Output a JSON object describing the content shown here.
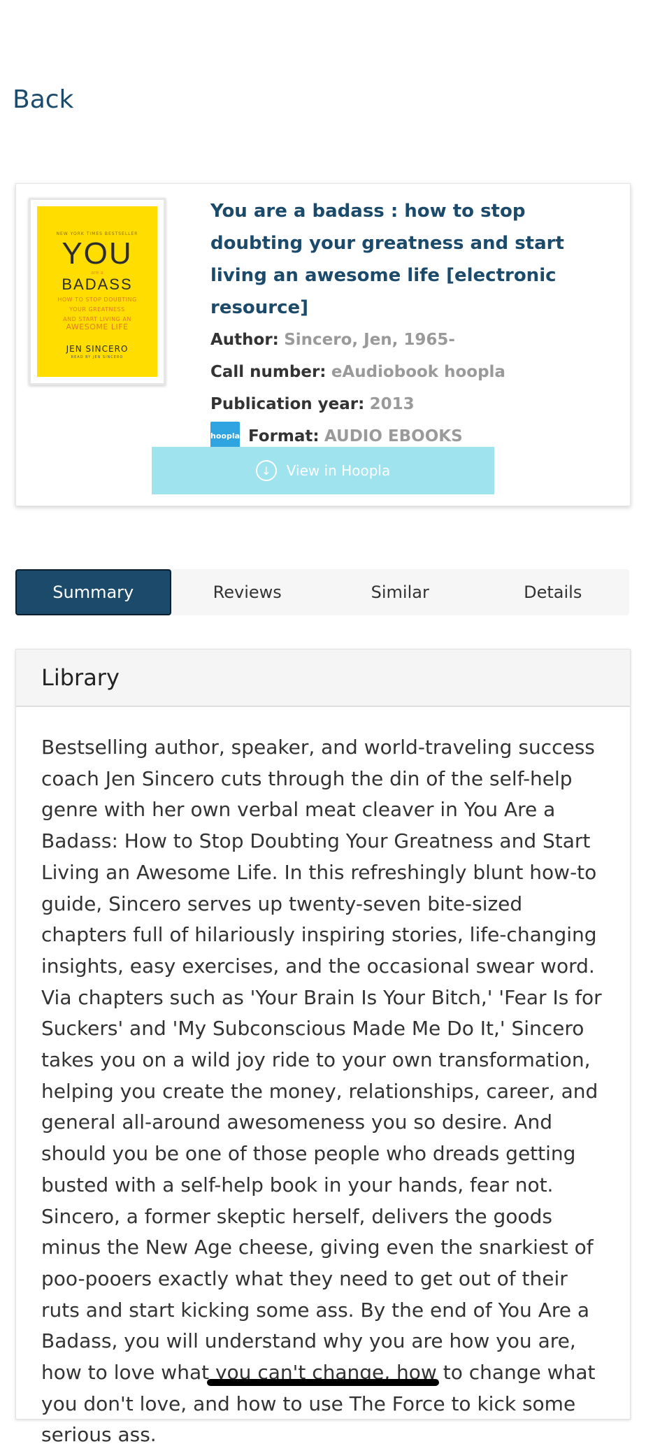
{
  "nav": {
    "back_label": "Back"
  },
  "book": {
    "title": "You are a badass : how to stop doubting your greatness and start living an awesome life [electronic resource]",
    "author_label": "Author:",
    "author": "Sincero, Jen, 1965-",
    "call_number_label": "Call number:",
    "call_number": "eAudiobook hoopla",
    "pub_year_label": "Publication year:",
    "pub_year": "2013",
    "format_label": "Format:",
    "format": "AUDIO EBOOKS",
    "format_badge": "hoopla",
    "cover": {
      "top_text": "NEW YORK TIMES BESTSELLER",
      "you": "YOU",
      "are_a": "are a",
      "badass": "BADASS",
      "sub_lines": [
        "HOW TO STOP DOUBTING",
        "YOUR GREATNESS",
        "AND START LIVING AN"
      ],
      "awesome": "AWESOME LIFE",
      "author": "JEN SINCERO",
      "read_by": "READ BY JEN SINCERO"
    },
    "view_button_label": "View in Hoopla"
  },
  "tabs": [
    {
      "label": "Summary",
      "active": true
    },
    {
      "label": "Reviews",
      "active": false
    },
    {
      "label": "Similar",
      "active": false
    },
    {
      "label": "Details",
      "active": false
    }
  ],
  "panel": {
    "heading": "Library",
    "summary": "Bestselling author, speaker, and world-traveling success coach Jen Sincero cuts through the din of the self-help genre with her own verbal meat cleaver in You Are a Badass: How to Stop Doubting Your Greatness and Start Living an Awesome Life. In this refreshingly blunt how-to guide, Sincero serves up twenty-seven bite-sized chapters full of hilariously inspiring stories, life-changing insights, easy exercises, and the occasional swear word. Via chapters such as 'Your Brain Is Your Bitch,' 'Fear Is for Suckers' and 'My Subconscious Made Me Do It,' Sincero takes you on a wild joy ride to your own transformation, helping you create the money, relationships, career, and general all-around awesomeness you so desire. And should you be one of those people who dreads getting busted with a self-help book in your hands, fear not. Sincero, a former skeptic herself, delivers the goods minus the New Age cheese, giving even the snarkiest of poo-pooers exactly what they need to get out of their ruts and start kicking some ass. By the end of You Are a Badass, you will understand why you are how you are, how to love what you can't change, how to change what you don't love, and how to use The Force to kick some serious ass."
  },
  "colors": {
    "accent": "#1b4a6b",
    "button": "#9fe3ef",
    "hoopla_badge": "#2fa4e0",
    "cover": "#ffdd00"
  }
}
